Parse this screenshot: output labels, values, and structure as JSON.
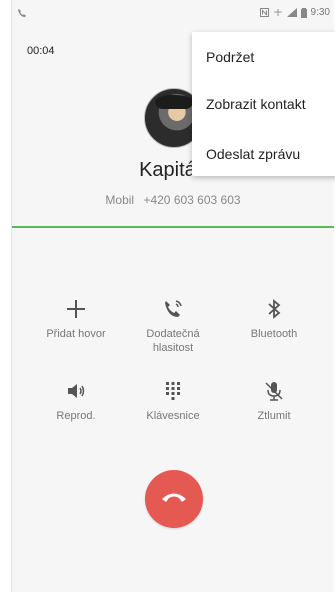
{
  "status_bar": {
    "time": "9:30",
    "icons": [
      "call-icon",
      "nfc-icon",
      "data-icon",
      "signal-icon",
      "battery-icon"
    ]
  },
  "call": {
    "duration": "00:04",
    "contact_name": "Kapitán",
    "number_type": "Mobil",
    "number": "+420 603 603 603"
  },
  "controls": [
    {
      "label_line1": "Přidat hovor",
      "label_line2": "",
      "icon": "plus-icon"
    },
    {
      "label_line1": "Dodatečná",
      "label_line2": "hlasitost",
      "icon": "volume-boost-icon"
    },
    {
      "label_line1": "Bluetooth",
      "label_line2": "",
      "icon": "bluetooth-icon"
    },
    {
      "label_line1": "Reprod.",
      "label_line2": "",
      "icon": "speaker-icon"
    },
    {
      "label_line1": "Klávesnice",
      "label_line2": "",
      "icon": "dialpad-icon"
    },
    {
      "label_line1": "Ztlumit",
      "label_line2": "",
      "icon": "mute-mic-icon"
    }
  ],
  "menu": {
    "items": [
      "Podržet",
      "Zobrazit kontakt",
      "Odeslat zprávu"
    ]
  },
  "colors": {
    "accent_green": "#5cb85c",
    "end_call_red": "#e45a53"
  }
}
